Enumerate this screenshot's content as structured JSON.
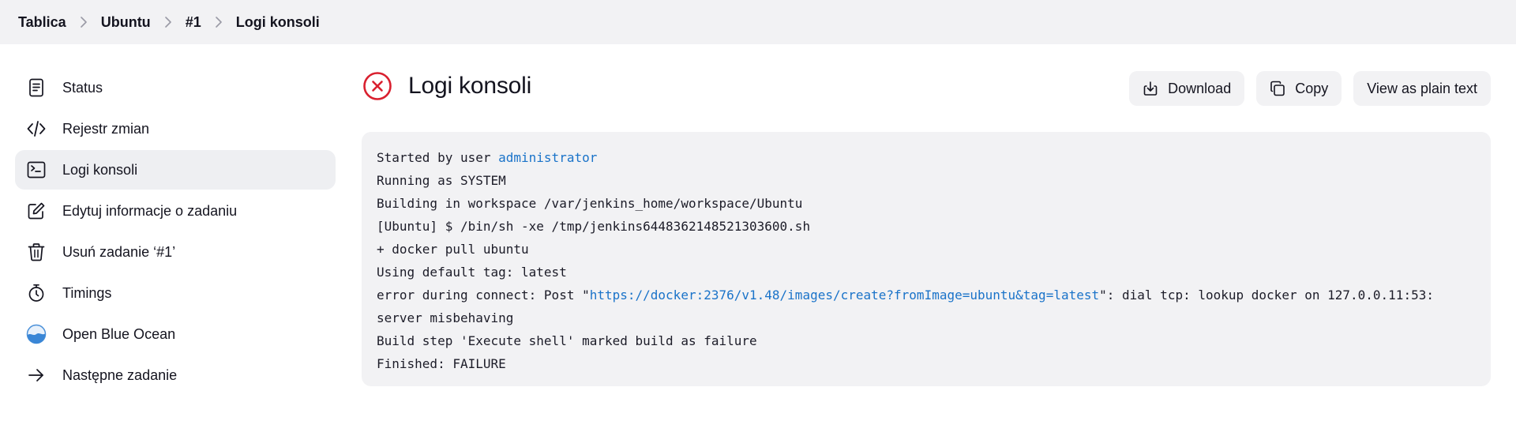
{
  "breadcrumb": {
    "items": [
      "Tablica",
      "Ubuntu",
      "#1",
      "Logi konsoli"
    ]
  },
  "sidebar": {
    "items": [
      {
        "label": "Status",
        "icon": "document-icon"
      },
      {
        "label": "Rejestr zmian",
        "icon": "code-icon"
      },
      {
        "label": "Logi konsoli",
        "icon": "terminal-icon",
        "active": true
      },
      {
        "label": "Edytuj informacje o zadaniu",
        "icon": "edit-icon"
      },
      {
        "label": "Usuń zadanie ‘#1’",
        "icon": "trash-icon"
      },
      {
        "label": "Timings",
        "icon": "stopwatch-icon"
      },
      {
        "label": "Open Blue Ocean",
        "icon": "blue-ocean-icon"
      },
      {
        "label": "Następne zadanie",
        "icon": "arrow-right-icon"
      }
    ]
  },
  "header": {
    "title": "Logi konsoli",
    "status": "failure",
    "status_color": "#d9202f"
  },
  "actions": {
    "download_label": "Download",
    "copy_label": "Copy",
    "plain_text_label": "View as plain text"
  },
  "console": {
    "line1_prefix": "Started by user ",
    "line1_user": "administrator",
    "line2": "Running as SYSTEM",
    "line3": "Building in workspace /var/jenkins_home/workspace/Ubuntu",
    "line4": "[Ubuntu] $ /bin/sh -xe /tmp/jenkins6448362148521303600.sh",
    "line5": "+ docker pull ubuntu",
    "line6": "Using default tag: latest",
    "line7_prefix": "error during connect: Post \"",
    "line7_link": "https://docker:2376/v1.48/images/create?fromImage=ubuntu&tag=latest",
    "line7_suffix": "\": dial tcp: lookup docker on 127.0.0.11:53:",
    "line8": "server misbehaving",
    "line9": "Build step 'Execute shell' marked build as failure",
    "line10": "Finished: FAILURE"
  },
  "colors": {
    "link": "#1a73c9",
    "failure": "#d9202f",
    "panel": "#f2f2f4"
  }
}
